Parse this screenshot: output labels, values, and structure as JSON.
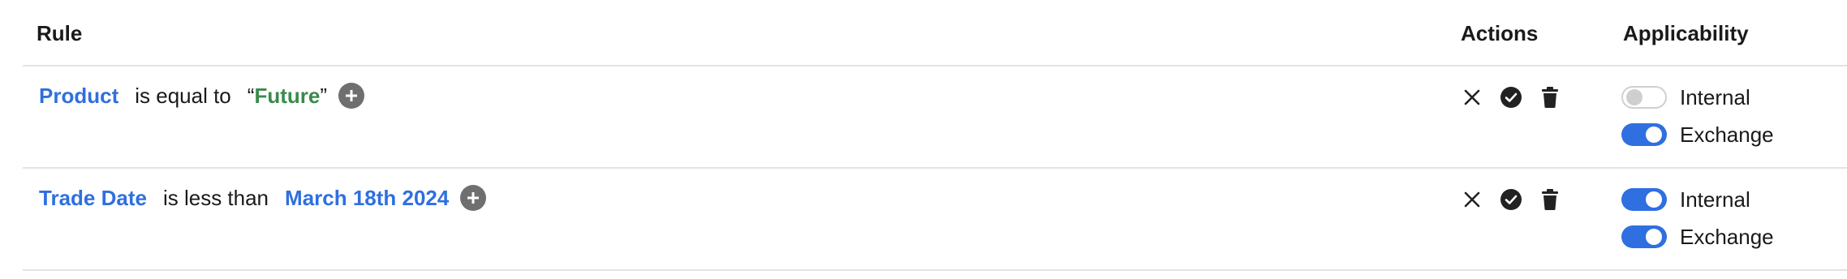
{
  "colors": {
    "link_blue": "#2f6fe0",
    "value_green": "#3a8a4c",
    "add_button_gray": "#6f6f6f",
    "toggle_on": "#2f6fe0",
    "divider": "#e3e3e3"
  },
  "header": {
    "rule": "Rule",
    "actions": "Actions",
    "applicability": "Applicability"
  },
  "rows": [
    {
      "field": "Product",
      "operator": "is equal to",
      "value_open_quote": "“",
      "value": "Future",
      "value_close_quote": "”",
      "value_style": "quoted-string",
      "actions": [
        "close-icon",
        "check-circle-icon",
        "trash-icon"
      ],
      "applicability": [
        {
          "label": "Internal",
          "on": false
        },
        {
          "label": "Exchange",
          "on": true
        }
      ]
    },
    {
      "field": "Trade Date",
      "operator": "is less than",
      "value": "March 18th 2024",
      "value_style": "date-link",
      "actions": [
        "close-icon",
        "check-circle-icon",
        "trash-icon"
      ],
      "applicability": [
        {
          "label": "Internal",
          "on": true
        },
        {
          "label": "Exchange",
          "on": true
        }
      ]
    }
  ]
}
